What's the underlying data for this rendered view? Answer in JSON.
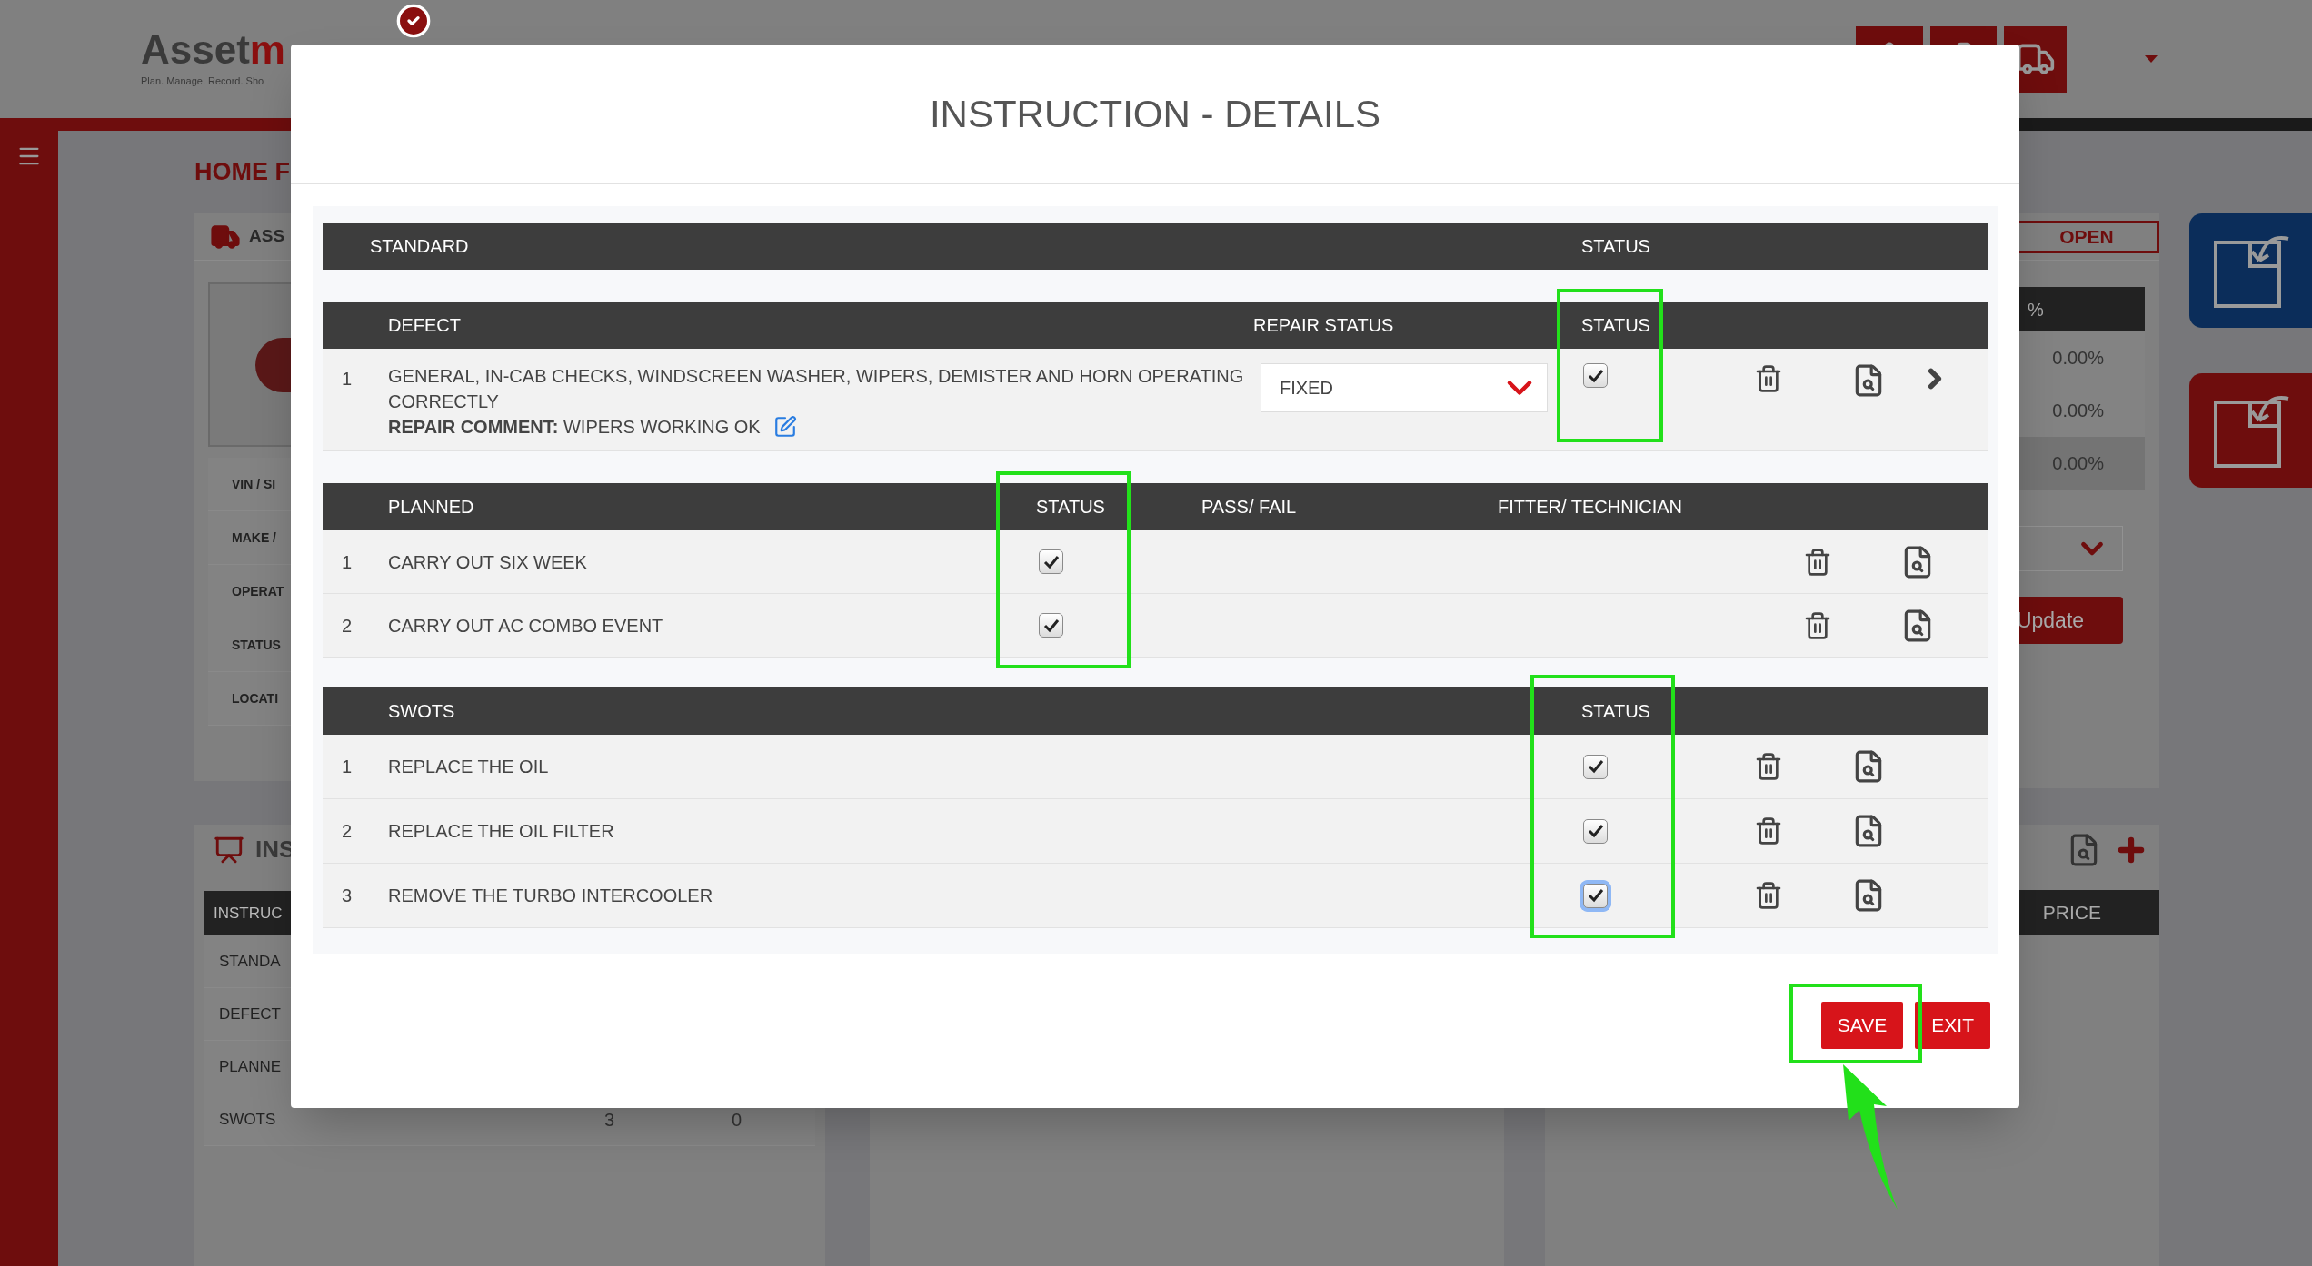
{
  "header": {
    "logo": {
      "dark": "Asset",
      "accent": "m"
    },
    "tagline": "Plan. Manage. Record. Sho"
  },
  "page_title": "HOME F",
  "asset_panel": {
    "title": "ASS",
    "fields": [
      "VIN / SI",
      "MAKE /",
      "OPERAT",
      "STATUS",
      "LOCATI"
    ]
  },
  "status_panel": {
    "badge": "OPEN",
    "columns": [
      "%"
    ],
    "rows": [
      {
        "value": "0.00%",
        "selected": false
      },
      {
        "value": "0.00%",
        "selected": false
      },
      {
        "value": "0.00%",
        "selected": true
      }
    ],
    "button": "Update"
  },
  "instructions_panel": {
    "title": "INS",
    "columns": [
      "INSTRUC"
    ],
    "rows": [
      {
        "label": "STANDA"
      },
      {
        "label": "DEFECT"
      },
      {
        "label": "PLANNE"
      },
      {
        "label": "SWOTS",
        "column_2": "3",
        "column_3": "0"
      }
    ]
  },
  "price_panel": {
    "columns": [
      "PRICE"
    ]
  },
  "modal": {
    "title": "INSTRUCTION - DETAILS",
    "standard": {
      "columns": [
        "STANDARD",
        "STATUS"
      ]
    },
    "defects": {
      "columns": [
        "DEFECT",
        "REPAIR STATUS",
        "STATUS"
      ],
      "rows": [
        {
          "number": "1",
          "description": "GENERAL, IN-CAB CHECKS, WINDSCREEN WASHER, WIPERS, DEMISTER AND HORN OPERATING CORRECTLY",
          "comment": "**REPAIR COMMENT:** WIPERS WORKING OK",
          "repair_status": "FIXED",
          "checked": true
        }
      ]
    },
    "planned": {
      "columns": [
        "PLANNED",
        "STATUS",
        "PASS/ FAIL",
        "FITTER/ TECHNICIAN"
      ],
      "rows": [
        {
          "number": "1",
          "task": "CARRY OUT SIX WEEK",
          "checked": true
        },
        {
          "number": "2",
          "task": "CARRY OUT AC COMBO EVENT",
          "checked": true
        }
      ]
    },
    "swots": {
      "columns": [
        "SWOTS",
        "STATUS"
      ],
      "rows": [
        {
          "number": "1",
          "task": "REPLACE THE OIL",
          "checked": true,
          "focused": false
        },
        {
          "number": "2",
          "task": "REPLACE THE OIL FILTER",
          "checked": true,
          "focused": false
        },
        {
          "number": "3",
          "task": "REMOVE THE TURBO INTERCOOLER",
          "checked": true,
          "focused": true
        }
      ]
    },
    "buttons": [
      {
        "label": "SAVE"
      },
      {
        "label": "EXIT"
      }
    ]
  }
}
